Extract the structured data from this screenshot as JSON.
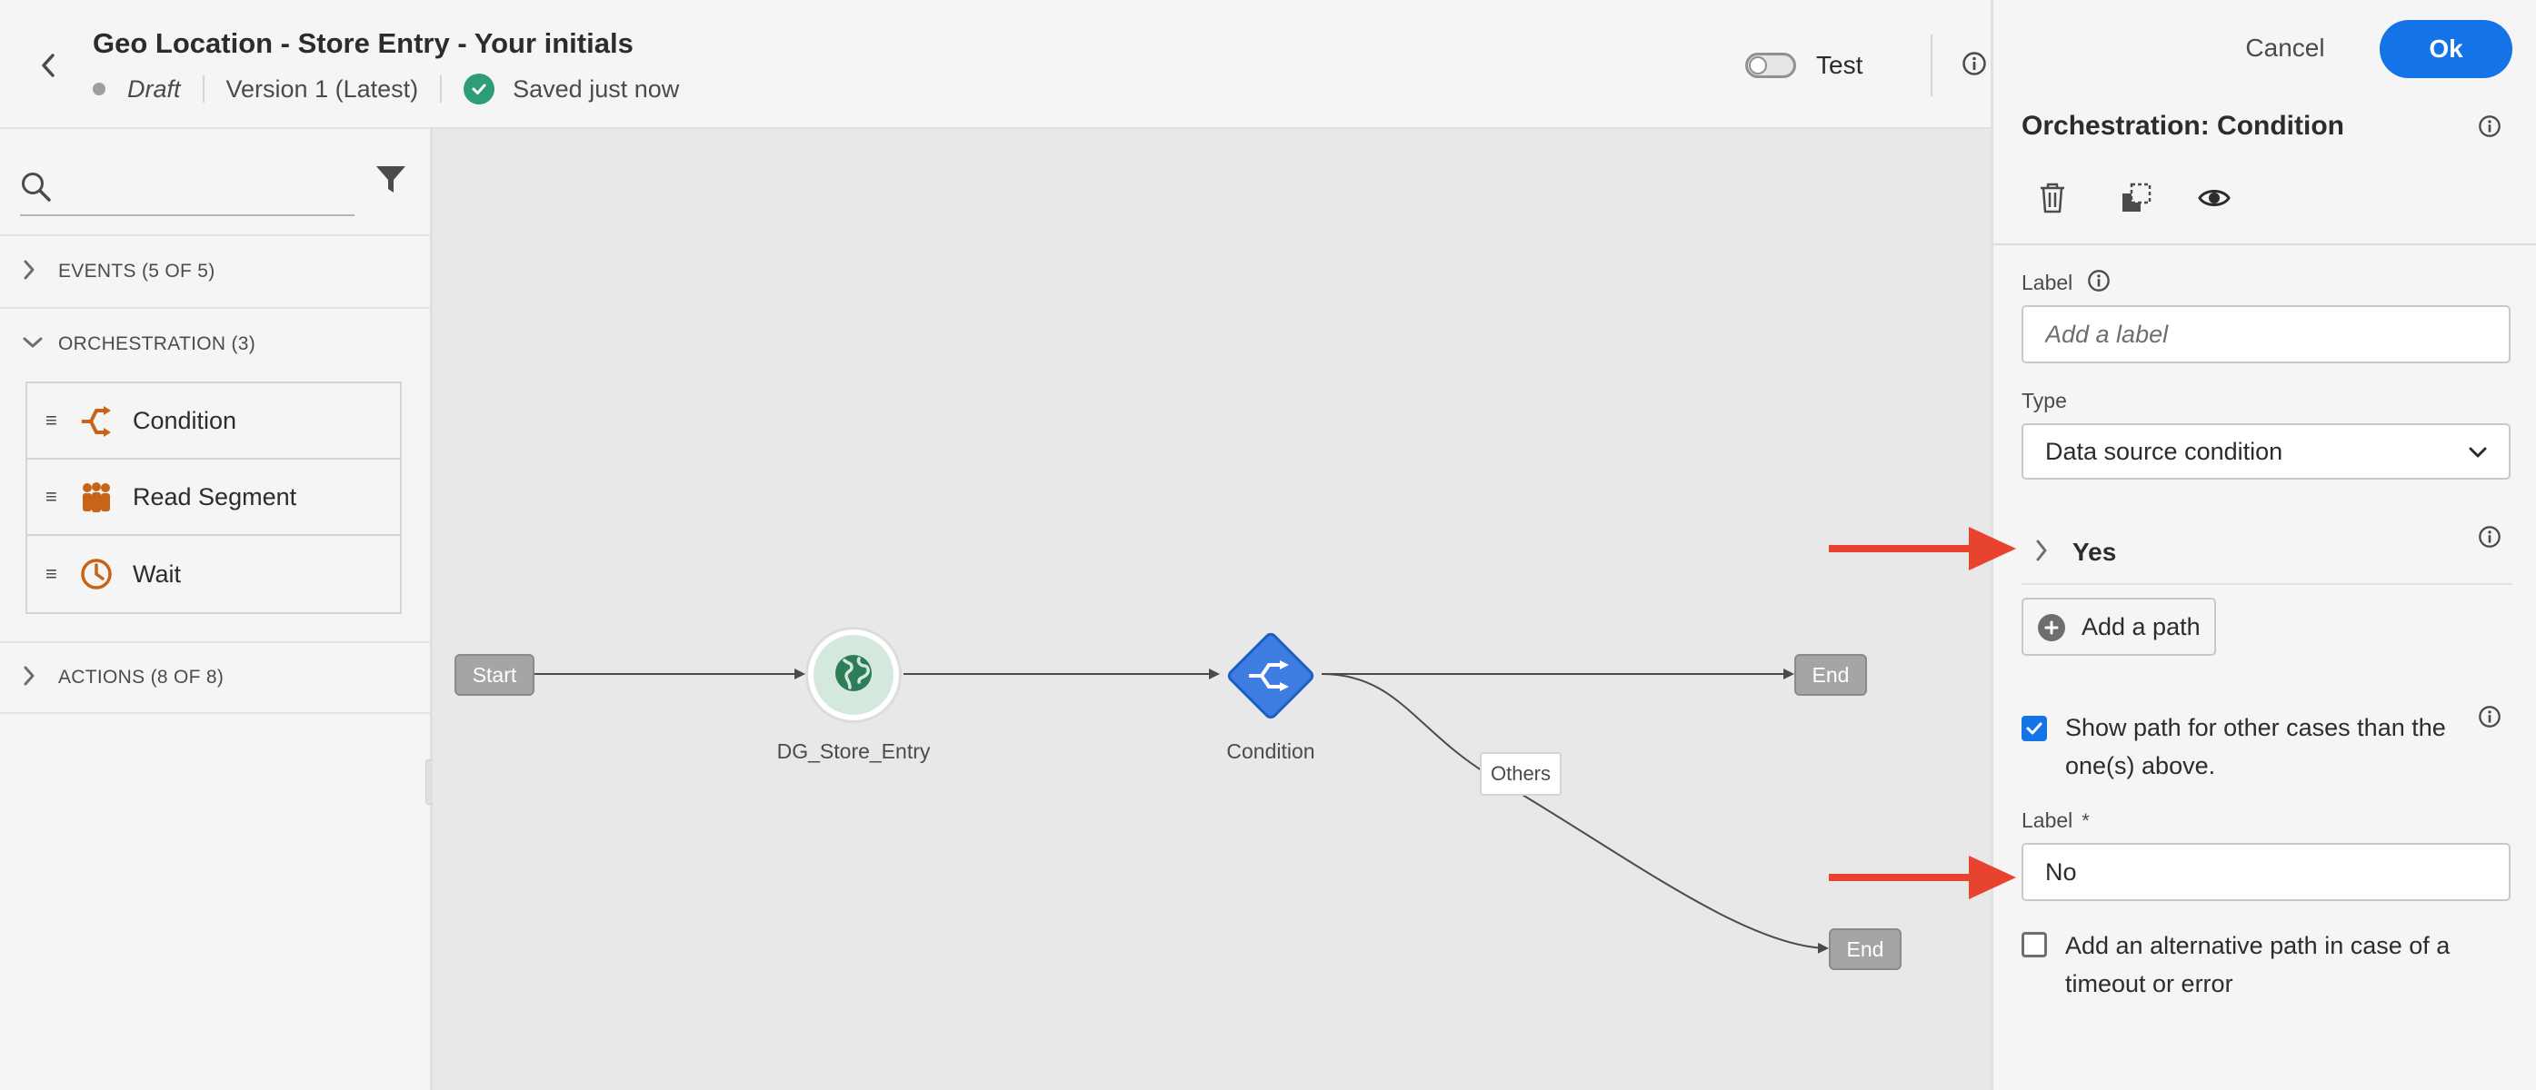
{
  "header": {
    "title": "Geo Location - Store Entry - Your initials",
    "status": "Draft",
    "version": "Version 1 (Latest)",
    "saved": "Saved just now",
    "test_label": "Test"
  },
  "palette": {
    "search_placeholder": "",
    "sections": {
      "events": "EVENTS (5 OF 5)",
      "orchestration": "ORCHESTRATION (3)",
      "actions": "ACTIONS (8 OF 8)"
    },
    "orchestration_items": [
      {
        "label": "Condition",
        "icon": "condition-icon"
      },
      {
        "label": "Read Segment",
        "icon": "people-icon"
      },
      {
        "label": "Wait",
        "icon": "clock-icon"
      }
    ]
  },
  "canvas": {
    "start": "Start",
    "entry_node_label": "DG_Store_Entry",
    "condition_node_label": "Condition",
    "end_top": "End",
    "end_bottom": "End",
    "others_tag": "Others"
  },
  "panel": {
    "cancel": "Cancel",
    "ok": "Ok",
    "title": "Orchestration: Condition",
    "label_field_label": "Label",
    "label_placeholder": "Add a label",
    "type_label": "Type",
    "type_value": "Data source condition",
    "yes_path": "Yes",
    "add_path": "Add a path",
    "show_path_text_1": "Show path for other cases than the",
    "show_path_text_2": "one(s) above.",
    "show_path_checked": true,
    "other_label_field_label": "Label",
    "other_label_required": "*",
    "other_label_value": "No",
    "alt_path_text_1": "Add an alternative path in case of a",
    "alt_path_text_2": "timeout or error",
    "alt_path_checked": false
  },
  "colors": {
    "accent": "#1473e6",
    "orchestration_icon": "#c86418",
    "event_node": "#2d7d58",
    "annotation_arrow": "#e8432e"
  }
}
